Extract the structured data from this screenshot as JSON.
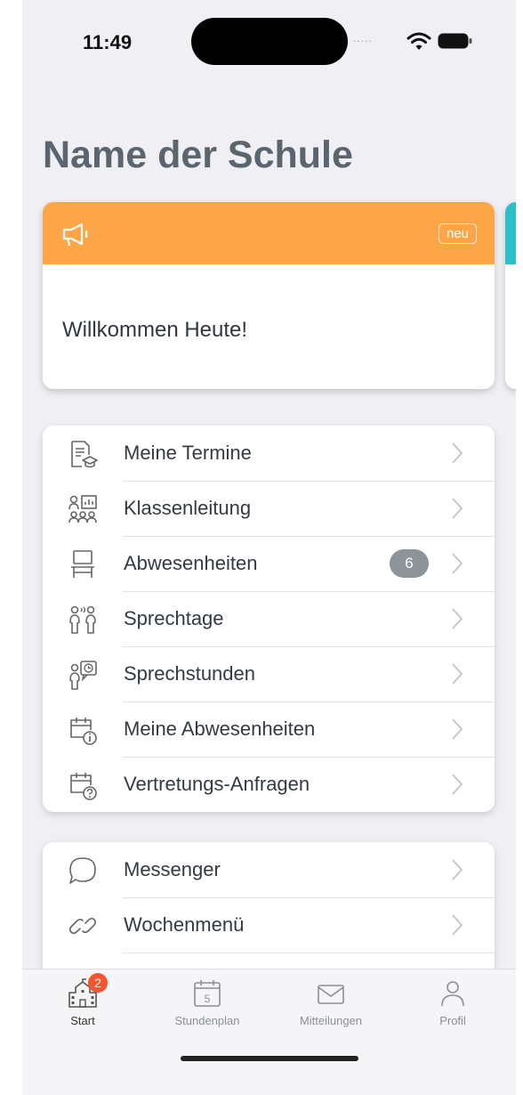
{
  "status_bar": {
    "time": "11:49",
    "signal": "....."
  },
  "page": {
    "title": "Name der Schule"
  },
  "announcement": {
    "badge": "neu",
    "text": "Willkommen Heute!",
    "header_color": "#fca648"
  },
  "menu_group_1": [
    {
      "label": "Meine Termine",
      "icon": "document-graduation-icon"
    },
    {
      "label": "Klassenleitung",
      "icon": "class-presentation-icon"
    },
    {
      "label": "Abwesenheiten",
      "icon": "chair-icon",
      "badge": "6"
    },
    {
      "label": "Sprechtage",
      "icon": "people-talking-icon"
    },
    {
      "label": "Sprechstunden",
      "icon": "person-clock-bubble-icon"
    },
    {
      "label": "Meine Abwesenheiten",
      "icon": "calendar-info-icon"
    },
    {
      "label": "Vertretungs-Anfragen",
      "icon": "calendar-question-icon"
    }
  ],
  "menu_group_2": [
    {
      "label": "Messenger",
      "icon": "chat-bubble-icon"
    },
    {
      "label": "Wochenmenü",
      "icon": "link-icon"
    }
  ],
  "tabbar": {
    "tabs": [
      {
        "label": "Start",
        "icon": "school-icon",
        "badge": "2",
        "active": true
      },
      {
        "label": "Stundenplan",
        "icon": "calendar-icon",
        "day": "5"
      },
      {
        "label": "Mitteilungen",
        "icon": "envelope-icon"
      },
      {
        "label": "Profil",
        "icon": "person-icon"
      }
    ]
  },
  "colors": {
    "accent_orange": "#fca648",
    "accent_teal": "#2dbfc6",
    "badge_red": "#f4542e",
    "title": "#5b6570"
  }
}
